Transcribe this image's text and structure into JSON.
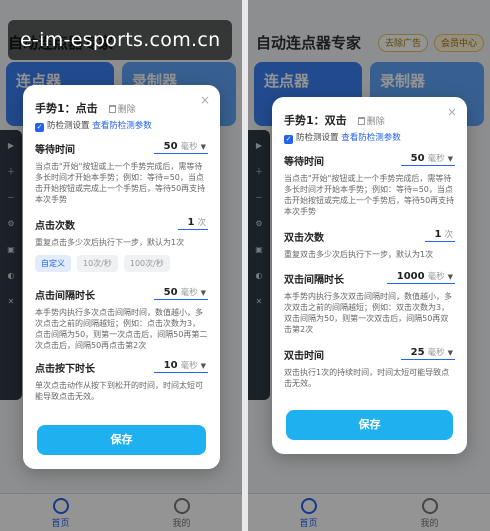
{
  "watermark": "e-im-esports.com.cn",
  "app": {
    "title": "自动连点器专家",
    "vip_badge": "去除广告",
    "member_badge": "会员中心",
    "card_clicker": "连点器",
    "card_recorder": "录制器",
    "tab_home": "首页",
    "tab_mine": "我的"
  },
  "colors": {
    "accent": "#2563eb",
    "save": "#1fb0f0"
  },
  "dialog_left": {
    "title": "手势1：点击",
    "delete": "删除",
    "close_icon": "×",
    "anti_detect_label": "防检测设置",
    "anti_detect_link": "查看防检测参数",
    "wait": {
      "label": "等待时间",
      "value": "50",
      "unit": "毫秒",
      "desc": "当点击\"开始\"按钮或上一个手势完成后，需等待多长时间才开始本手势；例如：等待=50，当点击开始按钮或完成上一个手势后，等待50再支持本次手势"
    },
    "count": {
      "label": "点击次数",
      "value": "1",
      "unit": "次",
      "desc": "重复点击多少次后执行下一步，默认为1次",
      "speeds": [
        "自定义",
        "10次/秒",
        "100次/秒"
      ]
    },
    "interval": {
      "label": "点击间隔时长",
      "value": "50",
      "unit": "毫秒",
      "desc": "本手势内执行多次点击间隔时间，数值越小，多次点击之前的间隔越短；例如：点击次数为3，点击间隔为50，则第一次点击后，间隔50再第二次点击后，间隔50再点击第2次"
    },
    "press": {
      "label": "点击按下时长",
      "value": "10",
      "unit": "毫秒",
      "desc": "单次点击动作从按下到松开的时间，时间太短可能导致点击无效。"
    },
    "save": "保存"
  },
  "dialog_right": {
    "title": "手势1：双击",
    "delete": "删除",
    "close_icon": "×",
    "anti_detect_label": "防检测设置",
    "anti_detect_link": "查看防检测参数",
    "wait": {
      "label": "等待时间",
      "value": "50",
      "unit": "毫秒",
      "desc": "当点击\"开始\"按钮或上一个手势完成后，需等待多长时间才开始本手势；例如：等待=50，当点击开始按钮或完成上一个手势后，等待50再支持本次手势"
    },
    "count": {
      "label": "双击次数",
      "value": "1",
      "unit": "次",
      "desc": "重复双击多少次后执行下一步，默认为1次"
    },
    "interval": {
      "label": "双击间隔时长",
      "value": "1000",
      "unit": "毫秒",
      "desc": "本手势内执行多次双击间隔时间，数值越小，多次双击之前的间隔越短；例如：双击次数为3，双击间隔为50，则第一次双击后，间隔50再双击第2次"
    },
    "duration": {
      "label": "双击时间",
      "value": "25",
      "unit": "毫秒",
      "desc": "双击执行1次的持续时间，时间太短可能导致点击无效。"
    },
    "save": "保存"
  }
}
